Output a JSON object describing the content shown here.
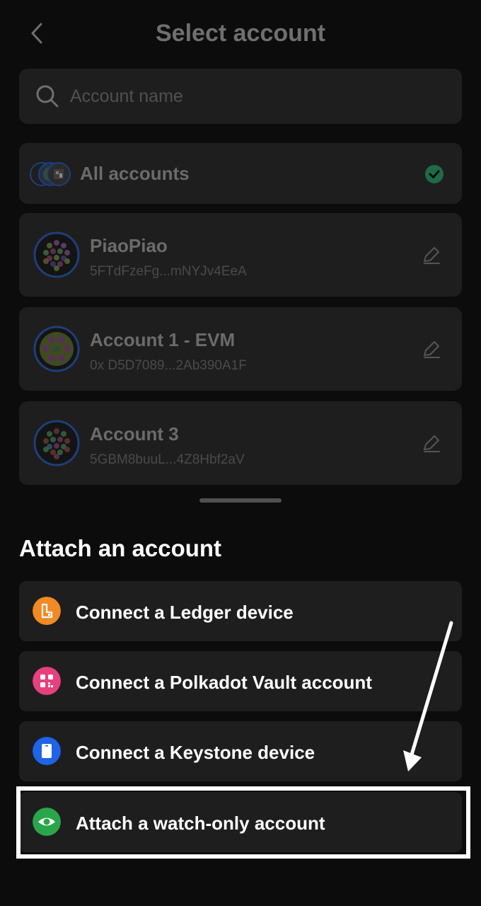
{
  "header": {
    "title": "Select account"
  },
  "search": {
    "placeholder": "Account name"
  },
  "all_accounts": {
    "label": "All accounts"
  },
  "accounts": [
    {
      "name": "PiaoPiao",
      "address": "5FTdFzeFg...mNYJv4EeA"
    },
    {
      "name": "Account 1 - EVM",
      "address": "0x D5D7089...2Ab390A1F"
    },
    {
      "name": "Account 3",
      "address": "5GBM8buuL...4Z8Hbf2aV"
    }
  ],
  "sheet": {
    "title": "Attach an account",
    "options": [
      {
        "label": "Connect a Ledger device",
        "icon": "ledger-icon",
        "color": "#f08a24"
      },
      {
        "label": "Connect a Polkadot Vault account",
        "icon": "qr-icon",
        "color": "#e6407f"
      },
      {
        "label": "Connect a Keystone device",
        "icon": "keystone-icon",
        "color": "#1e63e8"
      },
      {
        "label": "Attach a watch-only account",
        "icon": "eye-icon",
        "color": "#2aa64a"
      }
    ]
  },
  "colors": {
    "accent_check": "#2c9a63",
    "highlight": "#ffffff"
  }
}
